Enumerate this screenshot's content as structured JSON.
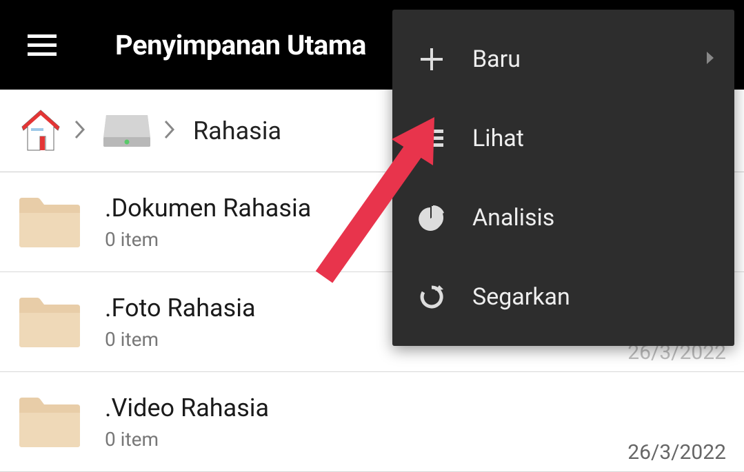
{
  "header": {
    "title": "Penyimpanan Utama"
  },
  "breadcrumb": {
    "current_path": "Rahasia"
  },
  "files": [
    {
      "name": ".Dokumen Rahasia",
      "meta": "0 item",
      "date": ""
    },
    {
      "name": ".Foto Rahasia",
      "meta": "0 item",
      "date": "26/3/2022"
    },
    {
      "name": ".Video Rahasia",
      "meta": "0 item",
      "date": "26/3/2022"
    }
  ],
  "menu": {
    "baru": "Baru",
    "lihat": "Lihat",
    "analisis": "Analisis",
    "segarkan": "Segarkan"
  }
}
